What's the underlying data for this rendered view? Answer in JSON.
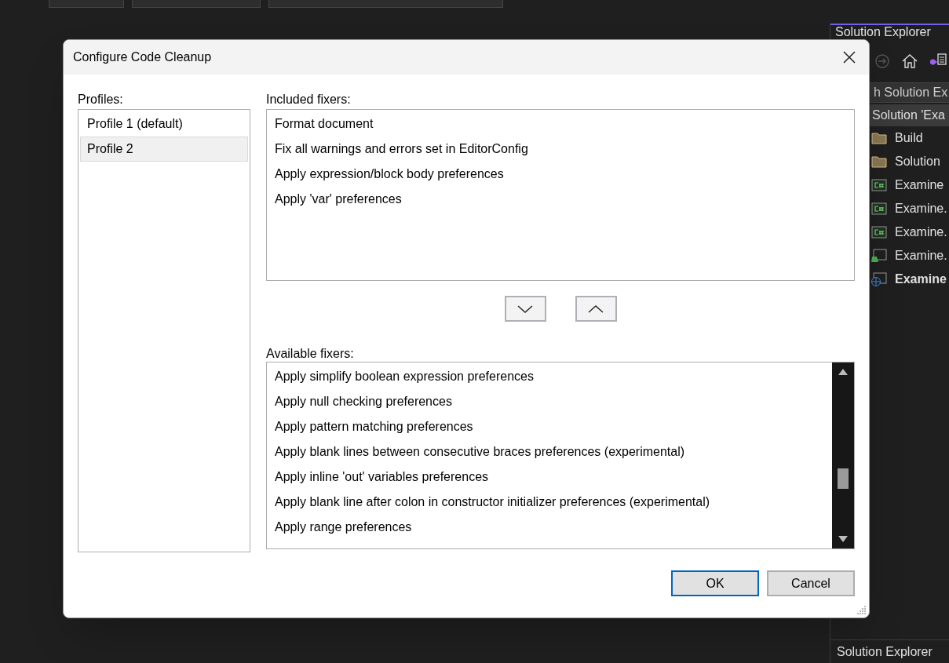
{
  "dialog": {
    "title": "Configure Code Cleanup",
    "profiles": {
      "label": "Profiles:",
      "items": [
        {
          "label": "Profile 1 (default)",
          "selected": false
        },
        {
          "label": "Profile 2",
          "selected": true
        }
      ]
    },
    "included_fixers": {
      "label": "Included fixers:",
      "items": [
        "Format document",
        "Fix all warnings and errors set in EditorConfig",
        "Apply expression/block body preferences",
        "Apply 'var' preferences"
      ]
    },
    "available_fixers": {
      "label": "Available fixers:",
      "items": [
        "Apply simplify boolean expression preferences",
        "Apply null checking preferences",
        "Apply pattern matching preferences",
        "Apply blank lines between consecutive braces preferences (experimental)",
        "Apply inline 'out' variables preferences",
        "Apply blank line after colon in constructor initializer preferences (experimental)",
        "Apply range preferences"
      ]
    },
    "buttons": [
      {
        "label": "OK",
        "default": true
      },
      {
        "label": "Cancel",
        "default": false
      }
    ]
  },
  "solution_explorer": {
    "title": "Solution Explorer",
    "search": "h Solution Ex",
    "tree": [
      {
        "label": "Solution 'Exa",
        "kind": "solution",
        "selected": true,
        "children": [
          {
            "label": "Build",
            "kind": "folder",
            "selected": false
          },
          {
            "label": "Solution",
            "kind": "folder",
            "selected": false
          },
          {
            "label": "Examine",
            "kind": "csharp",
            "selected": false
          },
          {
            "label": "Examine.",
            "kind": "csharp",
            "selected": false
          },
          {
            "label": "Examine.",
            "kind": "csharp",
            "selected": false
          },
          {
            "label": "Examine.",
            "kind": "test",
            "selected": false
          },
          {
            "label": "Examine",
            "kind": "web",
            "selected": false,
            "bold": true
          }
        ]
      }
    ],
    "bottom_tab": "Solution Explorer"
  }
}
